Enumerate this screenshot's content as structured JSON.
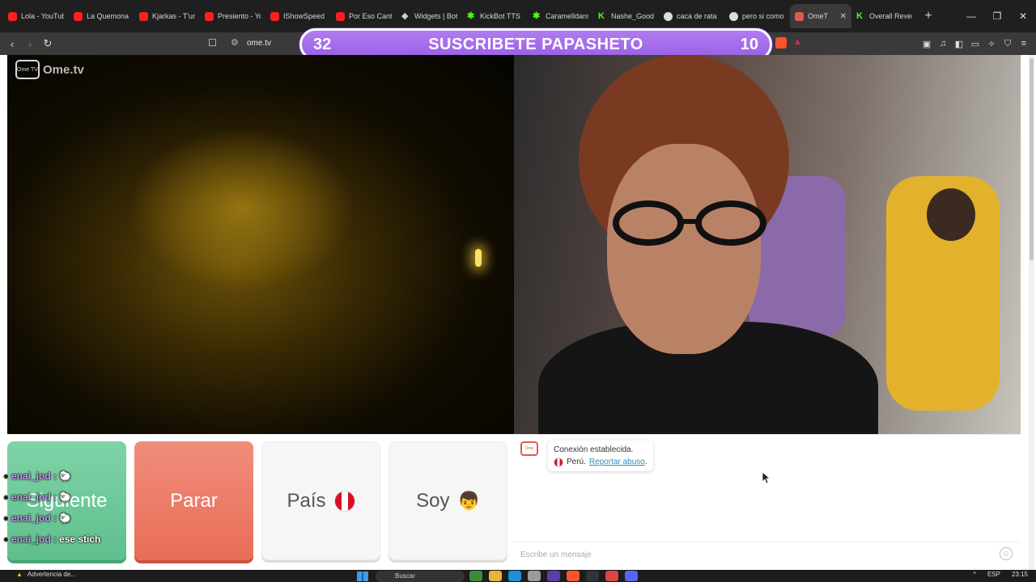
{
  "browser": {
    "tabs": [
      {
        "label": "Lola - YouTub",
        "icon": "youtube-icon"
      },
      {
        "label": "La Quemona",
        "icon": "youtube-icon"
      },
      {
        "label": "Kjarkas - T'un",
        "icon": "youtube-icon"
      },
      {
        "label": "Presiento - Yo",
        "icon": "youtube-icon"
      },
      {
        "label": "IShowSpeed",
        "icon": "youtube-icon"
      },
      {
        "label": "Por Eso Canto",
        "icon": "youtube-icon"
      },
      {
        "label": "Widgets | Bot",
        "icon": "diamond-icon"
      },
      {
        "label": "KickBot TTS S",
        "icon": "kickbot-icon"
      },
      {
        "label": "Caramelldans",
        "icon": "kickbot-icon"
      },
      {
        "label": "Nashe_Good",
        "icon": "kick-icon"
      },
      {
        "label": "caca de rata",
        "icon": "circle-icon"
      },
      {
        "label": "pero si como",
        "icon": "circle-icon"
      },
      {
        "label": "OmeT",
        "icon": "ometv-icon",
        "active": true
      },
      {
        "label": "Overall Rever",
        "icon": "kick-icon"
      }
    ],
    "new_tab": "+",
    "url": "ome.tv"
  },
  "banner": {
    "left_count": "32",
    "title": "SUSCRIBETE PAPASHETO",
    "right_count": "10"
  },
  "site": {
    "logo_text": "Ome.tv",
    "logo_badge": "Ome TV"
  },
  "buttons": {
    "next": "Siguiente",
    "stop": "Parar",
    "country": "País",
    "gender": "Soy"
  },
  "overlay_chat": [
    {
      "user": "enai_jod :",
      "msg": "🐑"
    },
    {
      "user": "enai_jod :",
      "msg": "🐑"
    },
    {
      "user": "enai_jod :",
      "msg": "🐑"
    },
    {
      "user": "enai_jod :",
      "msg": "ese stich"
    }
  ],
  "chat": {
    "system_title": "Conexión establecida.",
    "country": "Perú.",
    "report_link": "Reportar abuso",
    "report_suffix": ".",
    "input_placeholder": "Escribe un mensaje"
  },
  "taskbar": {
    "notification": "Advertencia de...",
    "search": "Buscar",
    "lang": "ESP",
    "time": "23:15"
  },
  "colors": {
    "next_button": "#6cc899",
    "stop_button": "#ea7762",
    "banner": "#a46ceb",
    "chat_user": "#c59cf6",
    "report_link": "#2f8fb8"
  }
}
